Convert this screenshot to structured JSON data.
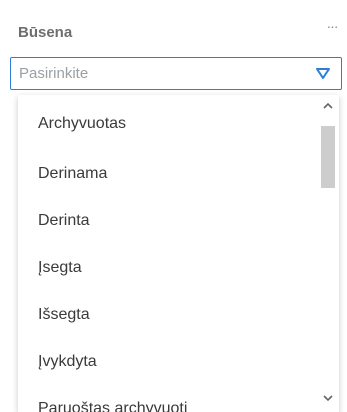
{
  "field": {
    "label": "Būsena",
    "more_icon": "more-horizontal-icon"
  },
  "select": {
    "placeholder": "Pasirinkite",
    "chevron_icon": "chevron-down-icon",
    "accent_color": "#2b7fd8"
  },
  "options": [
    {
      "label": "Archyvuotas"
    },
    {
      "label": "Derinama"
    },
    {
      "label": "Derinta"
    },
    {
      "label": "Įsegta"
    },
    {
      "label": "Išsegta"
    },
    {
      "label": "Įvykdyta"
    },
    {
      "label": "Paruoštas archyvuoti"
    }
  ],
  "scrollbar": {
    "up_icon": "scroll-up-icon",
    "down_icon": "scroll-down-icon"
  }
}
